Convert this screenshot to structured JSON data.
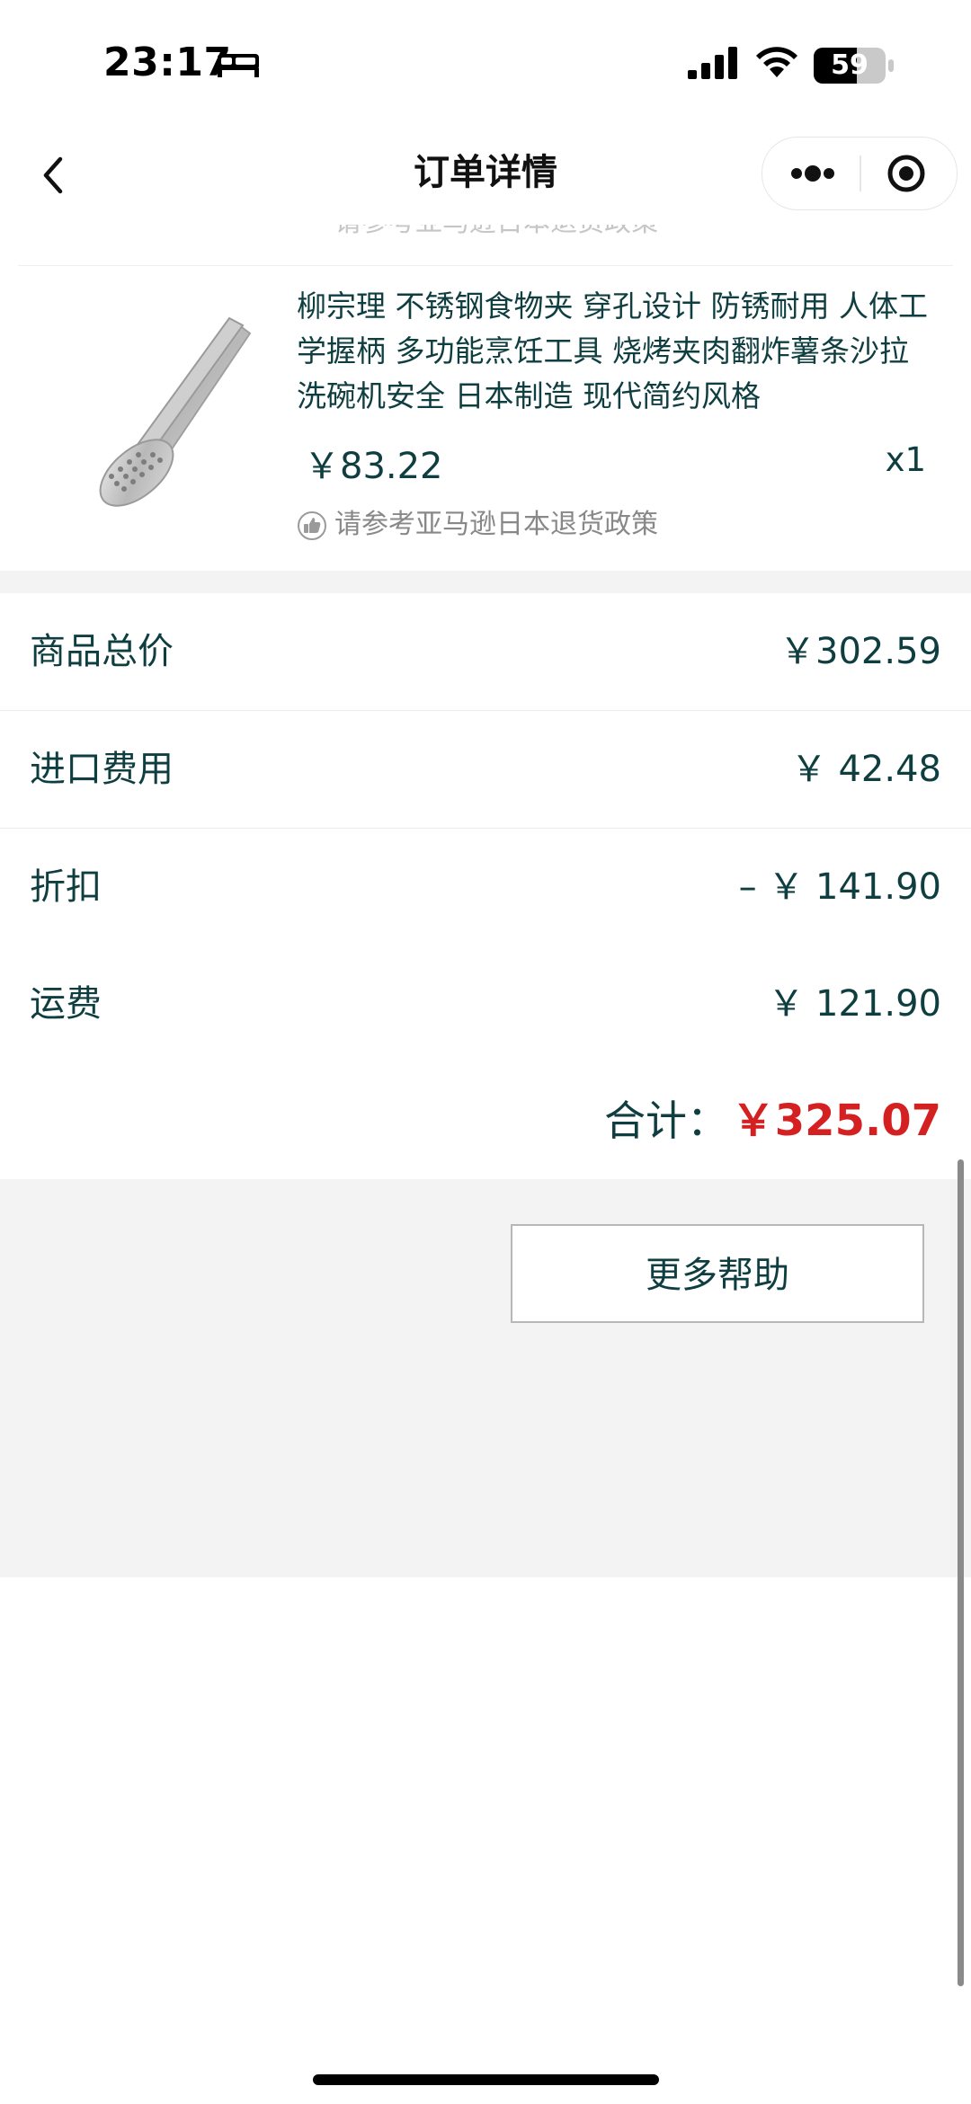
{
  "status_bar": {
    "time": "23:17",
    "battery": "59",
    "icons": [
      "bed-icon",
      "cellular-signal-icon",
      "wifi-icon",
      "battery-icon"
    ]
  },
  "nav": {
    "title": "订单详情",
    "back_icon": "chevron-left-icon",
    "more_icon": "more-dots-icon",
    "close_icon": "target-circle-icon"
  },
  "product_peek": {
    "policy_text": "请参考亚马逊日本退货政策"
  },
  "product": {
    "title": "柳宗理 不锈钢食物夹 穿孔设计 防锈耐用 人体工学握柄 多功能烹饪工具 烧烤夹肉翻炸薯条沙拉 洗碗机安全 日本制造 现代简约风格",
    "price": "￥83.22",
    "quantity": "x1",
    "policy_text": "请参考亚马逊日本退货政策",
    "image": "stainless-steel-tongs-image"
  },
  "summary": {
    "rows": [
      {
        "label": "商品总价",
        "value": "￥302.59"
      },
      {
        "label": "进口费用",
        "value": "￥ 42.48"
      },
      {
        "label": "折扣",
        "value": "– ￥ 141.90"
      },
      {
        "label": "运费",
        "value": "￥ 121.90"
      }
    ],
    "total_label": "合计：",
    "total_value": "￥325.07",
    "accent_color": "#d42020",
    "text_color": "#0f3e40"
  },
  "actions": {
    "help_label": "更多帮助"
  }
}
